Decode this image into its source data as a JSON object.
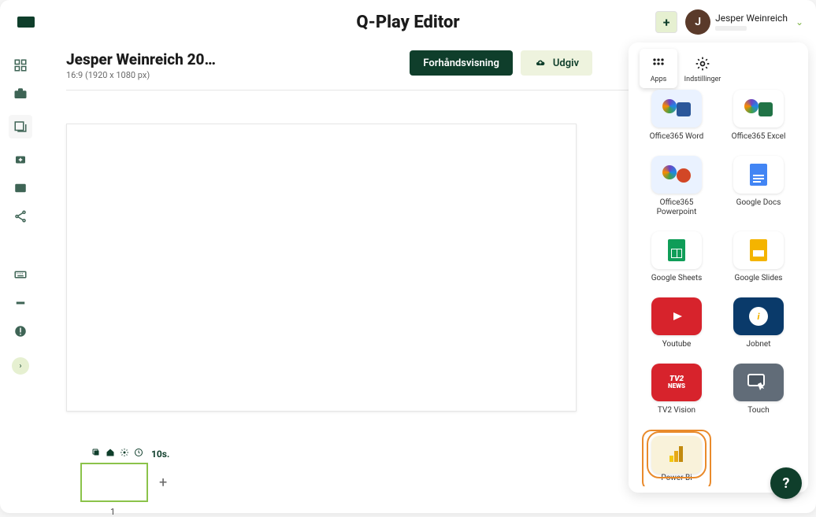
{
  "header": {
    "title": "Q-Play Editor",
    "plus": "+",
    "user_initial": "J",
    "user_name": "Jesper Weinreich"
  },
  "sidebar": {
    "items": [
      "dashboard",
      "briefcase",
      "design",
      "download",
      "image",
      "share"
    ],
    "items2": [
      "keyboard",
      "ticket",
      "alert"
    ]
  },
  "document": {
    "title": "Jesper Weinreich 20…",
    "subtitle": "16:9 (1920 x 1080 px)"
  },
  "buttons": {
    "preview": "Forhåndsvisning",
    "publish": "Udgiv"
  },
  "timeline": {
    "duration": "10s.",
    "slide_number": "1",
    "add": "+"
  },
  "panel": {
    "tabs": {
      "apps": "Apps",
      "settings": "Indstillinger"
    },
    "apps": [
      {
        "id": "office-word",
        "label": "Office365 Word",
        "tileClass": "tile-light"
      },
      {
        "id": "office-excel",
        "label": "Office365 Excel",
        "tileClass": "tile-white"
      },
      {
        "id": "office-ppt",
        "label": "Office365 Powerpoint",
        "tileClass": "tile-light"
      },
      {
        "id": "google-docs",
        "label": "Google Docs",
        "tileClass": "tile-white"
      },
      {
        "id": "google-sheets",
        "label": "Google Sheets",
        "tileClass": "tile-white"
      },
      {
        "id": "google-slides",
        "label": "Google Slides",
        "tileClass": "tile-white"
      },
      {
        "id": "youtube",
        "label": "Youtube",
        "tileClass": "tile-red"
      },
      {
        "id": "jobnet",
        "label": "Jobnet",
        "tileClass": "tile-navy"
      },
      {
        "id": "tv2vision",
        "label": "TV2 Vision",
        "tileClass": "tile-red"
      },
      {
        "id": "touch",
        "label": "Touch",
        "tileClass": "tile-grey"
      },
      {
        "id": "powerbi",
        "label": "Power Bi",
        "tileClass": "tile-cream",
        "selected": true
      }
    ]
  },
  "help": "?"
}
